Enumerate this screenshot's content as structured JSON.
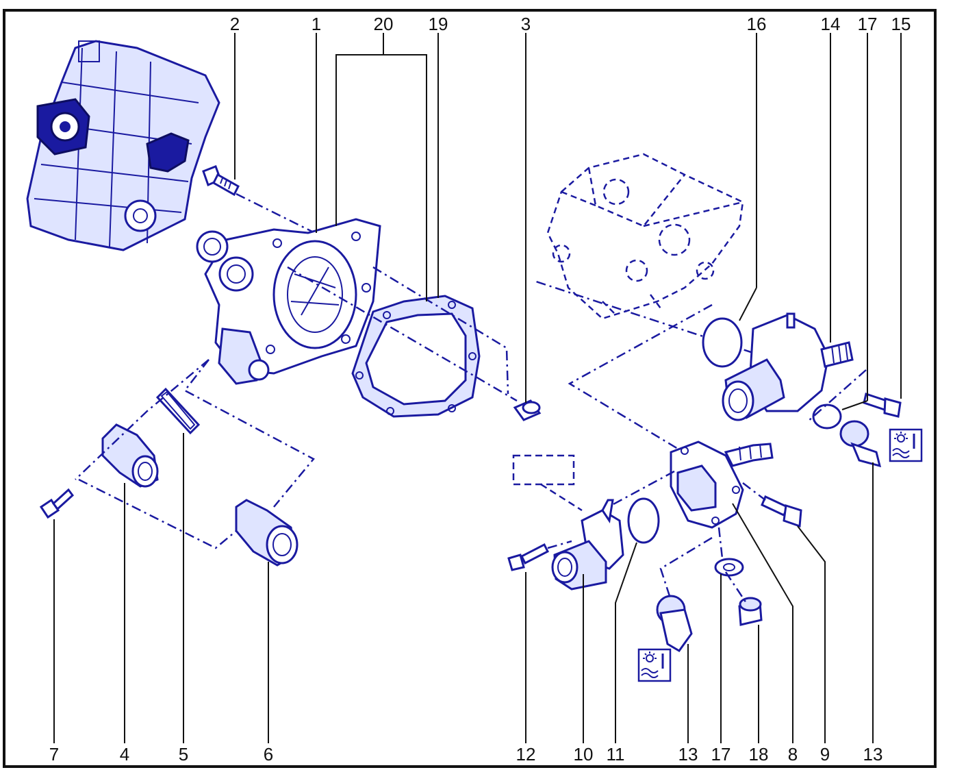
{
  "callouts_top": [
    "2",
    "1",
    "20",
    "19",
    "3",
    "16",
    "14",
    "17",
    "15"
  ],
  "callouts_bottom": [
    "7",
    "4",
    "5",
    "6",
    "12",
    "10",
    "11",
    "13",
    "17",
    "18",
    "8",
    "9",
    "13"
  ],
  "colors": {
    "line_art": "#1a1aa0",
    "frame": "#111111",
    "background": "#ffffff"
  },
  "icons": [
    "engine-thumbnail",
    "coolant-temperature-icon"
  ]
}
